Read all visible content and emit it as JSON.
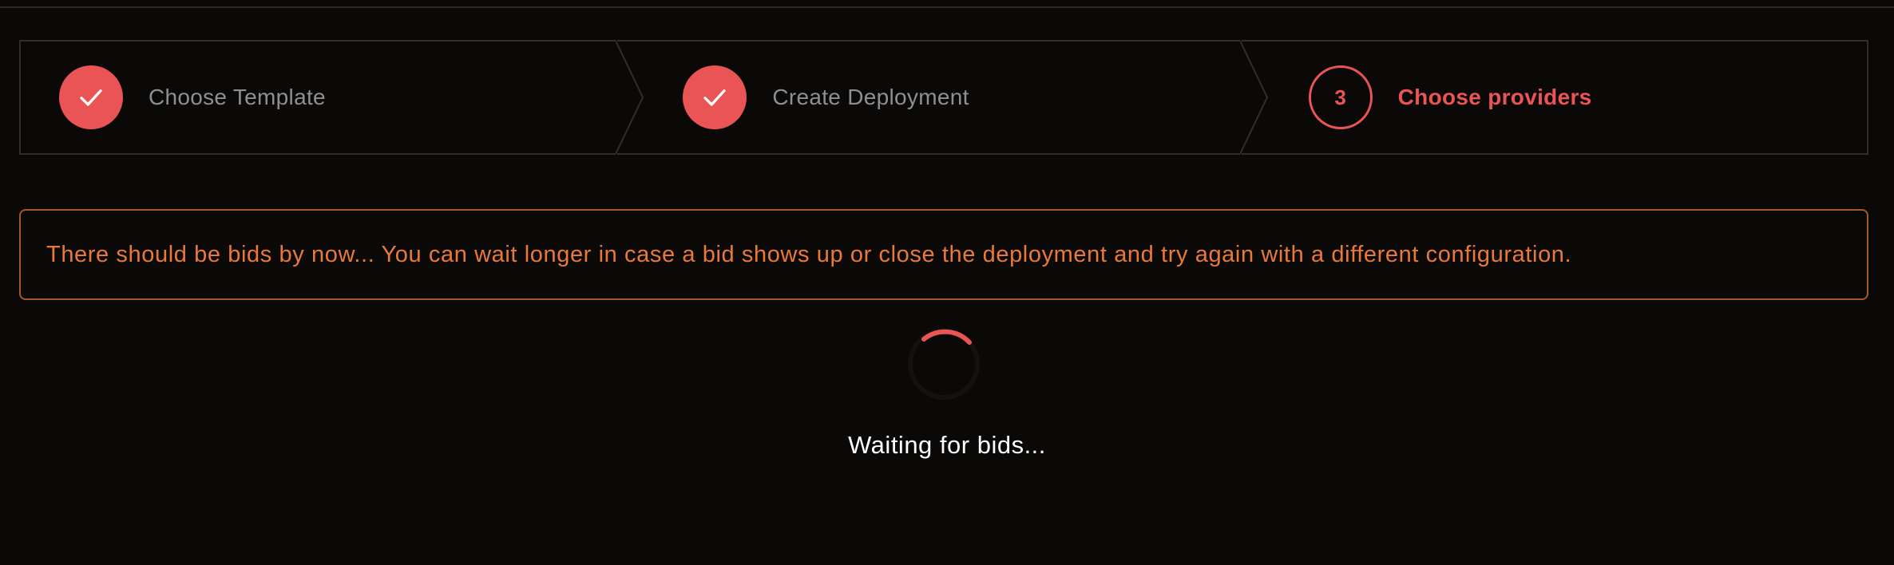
{
  "stepper": {
    "steps": [
      {
        "label": "Choose Template",
        "state": "done"
      },
      {
        "label": "Create Deployment",
        "state": "done"
      },
      {
        "label": "Choose providers",
        "state": "current",
        "number": "3"
      }
    ]
  },
  "alert": {
    "message": "There should be bids by now... You can wait longer in case a bid shows up or close the deployment and try again with a different configuration."
  },
  "status": {
    "waiting_text": "Waiting for bids..."
  },
  "colors": {
    "accent": "#ea5455",
    "warning": "#e8793a",
    "background": "#0a0908"
  },
  "icons": {
    "done_step": "check-icon",
    "loading": "spinner-icon"
  }
}
